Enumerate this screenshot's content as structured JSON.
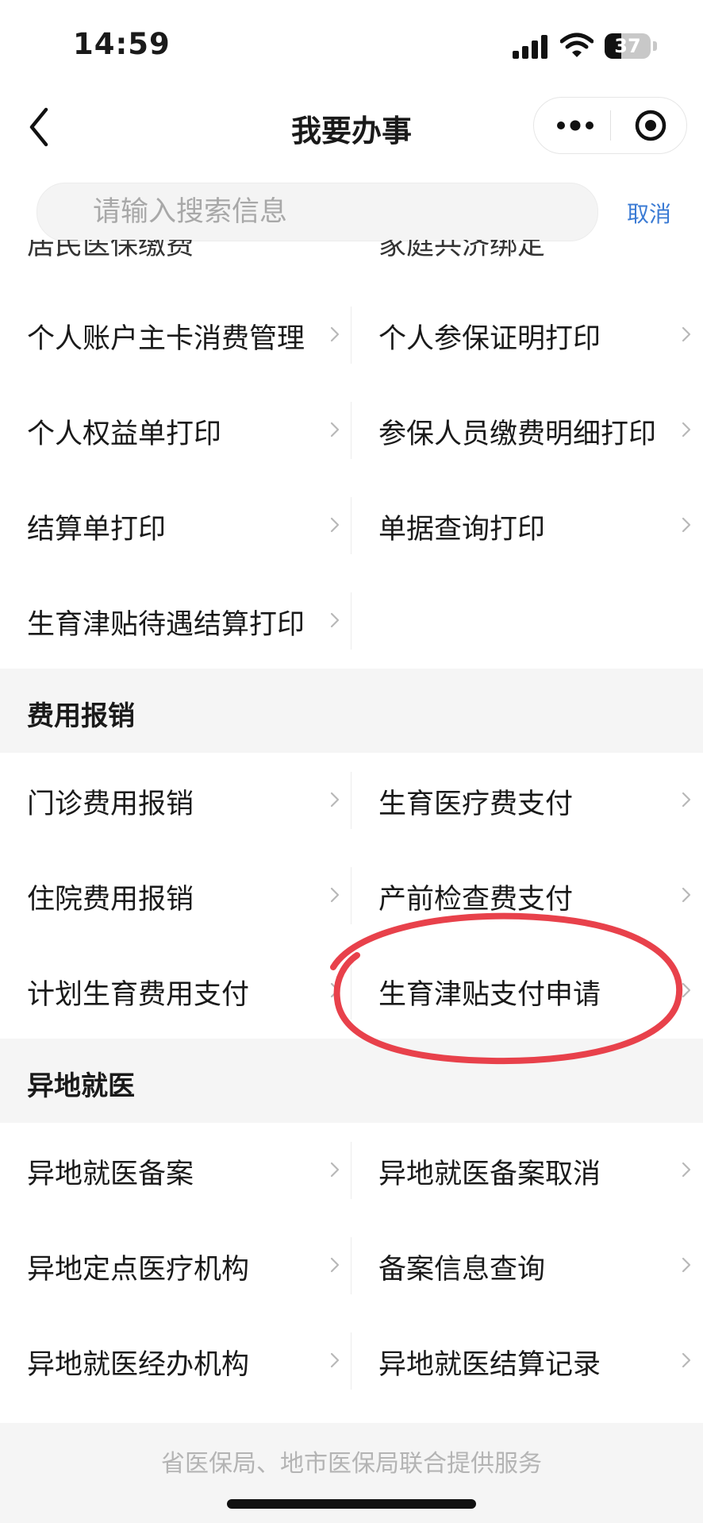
{
  "status_bar": {
    "time": "14:59",
    "battery": "37",
    "battery_level": 0.37
  },
  "nav": {
    "title": "我要办事"
  },
  "search": {
    "placeholder": "请输入搜索信息",
    "cancel_label": "取消"
  },
  "cutoff_row": {
    "left": "居民医保缴费",
    "right": "家庭共济绑定"
  },
  "groups": [
    {
      "title": "",
      "rows": [
        [
          "个人账户主卡消费管理",
          "个人参保证明打印"
        ],
        [
          "个人权益单打印",
          "参保人员缴费明细打印"
        ],
        [
          "结算单打印",
          "单据查询打印"
        ],
        [
          "生育津贴待遇结算打印",
          ""
        ]
      ]
    },
    {
      "title": "费用报销",
      "rows": [
        [
          "门诊费用报销",
          "生育医疗费支付"
        ],
        [
          "住院费用报销",
          "产前检查费支付"
        ],
        [
          "计划生育费用支付",
          "生育津贴支付申请"
        ]
      ]
    },
    {
      "title": "异地就医",
      "rows": [
        [
          "异地就医备案",
          "异地就医备案取消"
        ],
        [
          "异地定点医疗机构",
          "备案信息查询"
        ],
        [
          "异地就医经办机构",
          "异地就医结算记录"
        ]
      ]
    }
  ],
  "footer": {
    "text": "省医保局、地市医保局联合提供服务"
  },
  "colors": {
    "accent": "#3b7bd4",
    "annotation": "#e8414b",
    "section_bg": "#f5f5f5"
  }
}
